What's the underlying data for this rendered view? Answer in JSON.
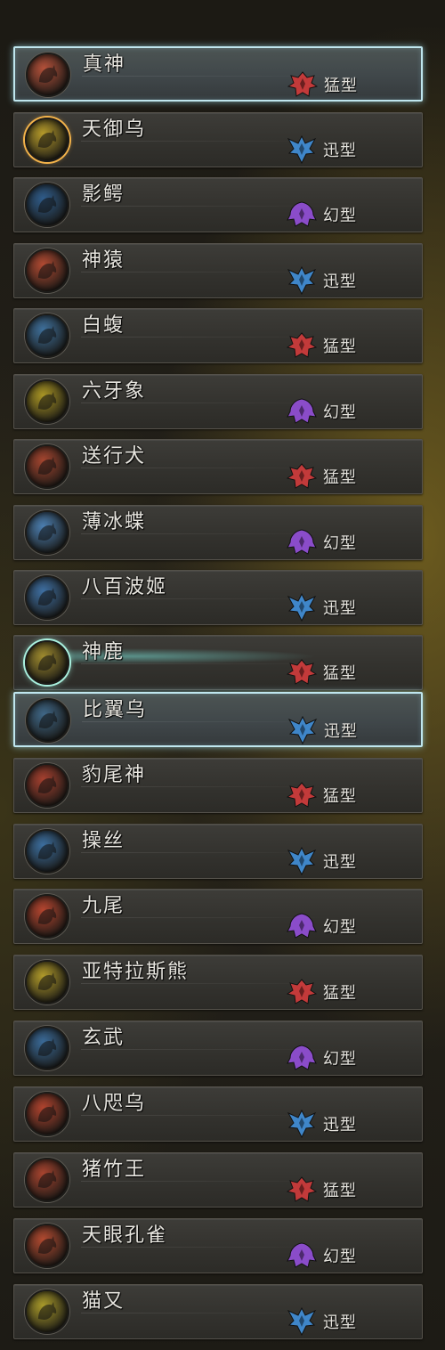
{
  "colors": {
    "meng": "#c23a3a",
    "xun": "#3f86c9",
    "huan": "#8a4cc9",
    "selected_border": "#bfe6ee",
    "gold_ring": "#f2b24a",
    "teal_ring": "#a9f0de"
  },
  "monsters": [
    {
      "name": "真神",
      "type": "猛型",
      "type_key": "meng",
      "icon": "dragon-crest-icon",
      "avatar_color": "#b4513a",
      "state": "selected"
    },
    {
      "name": "天御乌",
      "type": "迅型",
      "type_key": "xun",
      "icon": "bird-crest-icon",
      "avatar_color": "#b59a2a",
      "state": "gold"
    },
    {
      "name": "影鳄",
      "type": "幻型",
      "type_key": "huan",
      "icon": "ghost-crest-icon",
      "avatar_color": "#2f5c8a"
    },
    {
      "name": "神猿",
      "type": "迅型",
      "type_key": "xun",
      "icon": "bird-crest-icon",
      "avatar_color": "#b14a32"
    },
    {
      "name": "白蝮",
      "type": "猛型",
      "type_key": "meng",
      "icon": "dragon-crest-icon",
      "avatar_color": "#3e6f9a"
    },
    {
      "name": "六牙象",
      "type": "幻型",
      "type_key": "huan",
      "icon": "ghost-crest-icon",
      "avatar_color": "#a99524"
    },
    {
      "name": "送行犬",
      "type": "猛型",
      "type_key": "meng",
      "icon": "dragon-crest-icon",
      "avatar_color": "#a4452f"
    },
    {
      "name": "薄冰蝶",
      "type": "幻型",
      "type_key": "huan",
      "icon": "ghost-crest-icon",
      "avatar_color": "#4b7eb0"
    },
    {
      "name": "八百波姬",
      "type": "迅型",
      "type_key": "xun",
      "icon": "bird-crest-icon",
      "avatar_color": "#3e6fa2"
    },
    {
      "name": "神鹿",
      "type": "猛型",
      "type_key": "meng",
      "icon": "dragon-crest-icon",
      "avatar_color": "#9e8a2e",
      "state": "teal"
    },
    {
      "name": "比翼乌",
      "type": "迅型",
      "type_key": "xun",
      "icon": "bird-crest-icon",
      "avatar_color": "#3f6787",
      "state": "selected"
    },
    {
      "name": "豹尾神",
      "type": "猛型",
      "type_key": "meng",
      "icon": "dragon-crest-icon",
      "avatar_color": "#a5402f"
    },
    {
      "name": "操丝",
      "type": "迅型",
      "type_key": "xun",
      "icon": "bird-crest-icon",
      "avatar_color": "#3c6e9e"
    },
    {
      "name": "九尾",
      "type": "幻型",
      "type_key": "huan",
      "icon": "ghost-crest-icon",
      "avatar_color": "#b5452f"
    },
    {
      "name": "亚特拉斯熊",
      "type": "猛型",
      "type_key": "meng",
      "icon": "dragon-crest-icon",
      "avatar_color": "#b09a2a"
    },
    {
      "name": "玄武",
      "type": "幻型",
      "type_key": "huan",
      "icon": "ghost-crest-icon",
      "avatar_color": "#3a6a98"
    },
    {
      "name": "八咫乌",
      "type": "迅型",
      "type_key": "xun",
      "icon": "bird-crest-icon",
      "avatar_color": "#b0432e"
    },
    {
      "name": "猪竹王",
      "type": "猛型",
      "type_key": "meng",
      "icon": "dragon-crest-icon",
      "avatar_color": "#a8442f"
    },
    {
      "name": "天眼孔雀",
      "type": "幻型",
      "type_key": "huan",
      "icon": "ghost-crest-icon",
      "avatar_color": "#b24a30"
    },
    {
      "name": "猫又",
      "type": "迅型",
      "type_key": "xun",
      "icon": "bird-crest-icon",
      "avatar_color": "#a99a2a"
    }
  ]
}
